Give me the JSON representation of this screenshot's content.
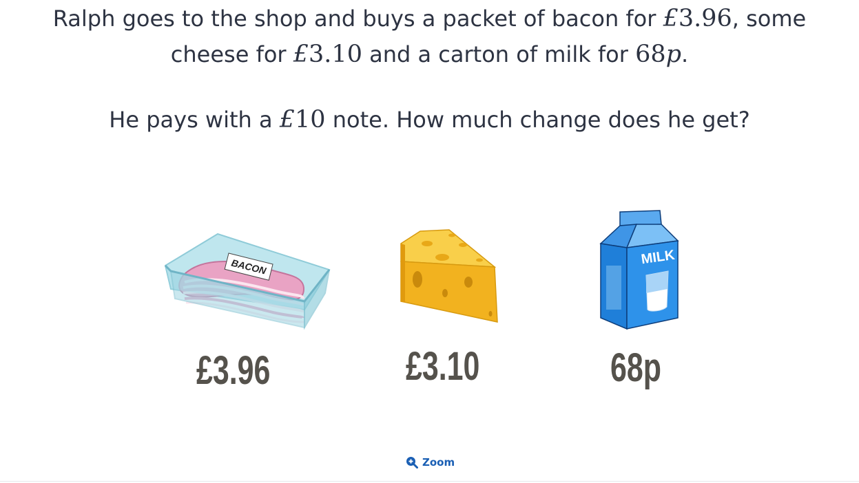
{
  "question": {
    "line1": {
      "text_before": "Ralph goes to the shop and buys a packet of bacon for ",
      "currency": "£",
      "amount": "3.96",
      "text_after": ", some"
    },
    "line2": {
      "text_before": "cheese for ",
      "currency": "£",
      "amount": "3.10",
      "text_middle": " and a carton of milk for ",
      "amount2": "68",
      "unit2": "p",
      "text_after": "."
    },
    "line3": {
      "text_before": "He pays with a ",
      "currency": "£",
      "amount": "10",
      "text_after": " note. How much change does he get?"
    }
  },
  "items": [
    {
      "icon": "bacon-packet-icon",
      "label_on_pack": "BACON",
      "price": "£3.96"
    },
    {
      "icon": "cheese-wedge-icon",
      "price": "£3.10"
    },
    {
      "icon": "milk-carton-icon",
      "label_on_pack": "MILK",
      "price": "68p"
    }
  ],
  "zoom": {
    "icon": "zoom-in-icon",
    "label": "Zoom"
  },
  "colors": {
    "text": "#2d3342",
    "price": "#55524c",
    "zoom_link": "#1a5fb4",
    "milk_blue": "#1f7fd9",
    "cheese_yellow": "#f2b21f",
    "bacon_pink": "#d98bb0"
  }
}
